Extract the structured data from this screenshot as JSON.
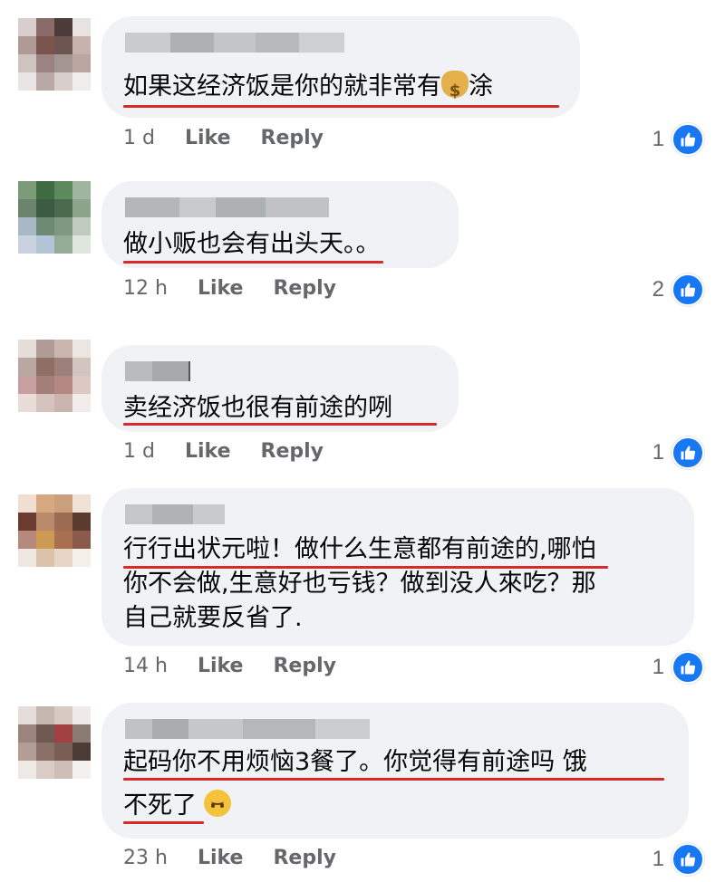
{
  "comments": [
    {
      "text": "如果这经济饭是你的就非常有",
      "text_suffix": "涂",
      "emoji": "money-bag",
      "time": "1 d",
      "like": "Like",
      "reply": "Reply",
      "reaction_count": "1"
    },
    {
      "text": "做小贩也会有出头天。。",
      "time": "12 h",
      "like": "Like",
      "reply": "Reply",
      "reaction_count": "2"
    },
    {
      "text": "卖经济饭也很有前途的咧",
      "time": "1 d",
      "like": "Like",
      "reply": "Reply",
      "reaction_count": "1"
    },
    {
      "lines": [
        "行行出状元啦！做什么生意都有前途的,哪怕",
        "你不会做,生意好也亏钱？做到没人來吃？那",
        "自己就要反省了."
      ],
      "time": "14 h",
      "like": "Like",
      "reply": "Reply",
      "reaction_count": "1"
    },
    {
      "lines": [
        "起码你不用烦恼3餐了。你觉得有前途吗 饿",
        "不死了"
      ],
      "emoji": "upside-down-face",
      "time": "23 h",
      "like": "Like",
      "reply": "Reply",
      "reaction_count": "1"
    }
  ],
  "colors": {
    "bubble": "#f0f2f5",
    "underline": "#d92a2a",
    "like_blue": "#1877f2",
    "meta_gray": "#65676b"
  }
}
